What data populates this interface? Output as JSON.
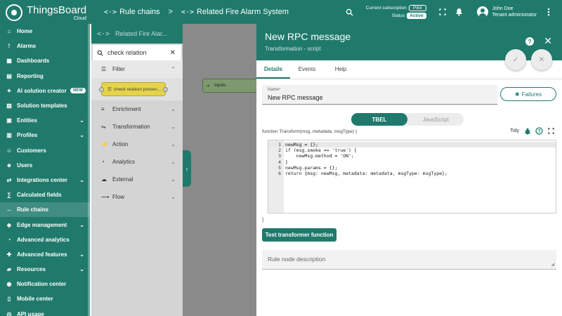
{
  "app": {
    "brand": "ThingsBoard",
    "brand_sub": "Cloud",
    "breadcrumbs": [
      "Rule chains",
      "Related Fire Alarm System"
    ],
    "breadcrumb_sep": ">",
    "subscription_label": "Current subscription",
    "subscription_value": "Pilot",
    "status_label": "Status",
    "status_value": "Active",
    "user_name": "John Doe",
    "user_role": "Tenant administrator",
    "accent_color": "#1f7a6c"
  },
  "sidebar": {
    "items": [
      {
        "label": "Home",
        "icon": "home-icon",
        "chev": ""
      },
      {
        "label": "Alarms",
        "icon": "bell-icon",
        "chev": ""
      },
      {
        "label": "Dashboards",
        "icon": "dashboard-icon",
        "chev": ""
      },
      {
        "label": "Reporting",
        "icon": "report-icon",
        "chev": ""
      },
      {
        "label": "AI solution creator",
        "icon": "ai-icon",
        "chev": "",
        "badge": "NEW"
      },
      {
        "label": "Solution templates",
        "icon": "template-icon",
        "chev": ""
      },
      {
        "label": "Entities",
        "icon": "entities-icon",
        "chev": "⌄"
      },
      {
        "label": "Profiles",
        "icon": "profiles-icon",
        "chev": "⌄"
      },
      {
        "label": "Customers",
        "icon": "customers-icon",
        "chev": ""
      },
      {
        "label": "Users",
        "icon": "users-icon",
        "chev": ""
      },
      {
        "label": "Integrations center",
        "icon": "integrations-icon",
        "chev": "⌄"
      },
      {
        "label": "Calculated fields",
        "icon": "calc-icon",
        "chev": ""
      },
      {
        "label": "Rule chains",
        "icon": "rule-chains-icon",
        "chev": "",
        "active": true
      },
      {
        "label": "Edge management",
        "icon": "edge-icon",
        "chev": "⌄"
      },
      {
        "label": "Advanced analytics",
        "icon": "analytics-icon",
        "chev": ""
      },
      {
        "label": "Advanced features",
        "icon": "features-icon",
        "chev": "⌄"
      },
      {
        "label": "Resources",
        "icon": "folder-icon",
        "chev": "⌄"
      },
      {
        "label": "Notification center",
        "icon": "notification-icon",
        "chev": ""
      },
      {
        "label": "Mobile center",
        "icon": "mobile-icon",
        "chev": ""
      },
      {
        "label": "API usage",
        "icon": "api-icon",
        "chev": ""
      }
    ]
  },
  "library": {
    "header": "Related Fire Alar...",
    "search_value": "check relation",
    "filter_label": "Filter",
    "node_label": "check relation presen...",
    "categories": [
      "Enrichment",
      "Transformation",
      "Action",
      "Analytics",
      "External",
      "Flow"
    ]
  },
  "canvas": {
    "node_label": "Inputs"
  },
  "dialog": {
    "title": "New RPC message",
    "subtitle": "Transformation - script",
    "tabs": [
      "Details",
      "Events",
      "Help"
    ],
    "name_label": "Name*",
    "name_value": "New RPC message",
    "failures_label": "Failures",
    "lang_on": "TBEL",
    "lang_off": "JavaScript",
    "fn_signature": "function Transform(msg, metadata, msgType) {",
    "tidy_label": "Tidy",
    "code_lines": [
      "newMsg = {};",
      "if (msg.smoke == 'true') {",
      "    newMsg.method = 'ON';",
      "}",
      "newMsg.params = {};",
      "return {msg: newMsg, metadata: metadata, msgType: msgType};"
    ],
    "close_brace": "}",
    "test_button": "Test transformer function",
    "description_placeholder": "Rule node description"
  }
}
